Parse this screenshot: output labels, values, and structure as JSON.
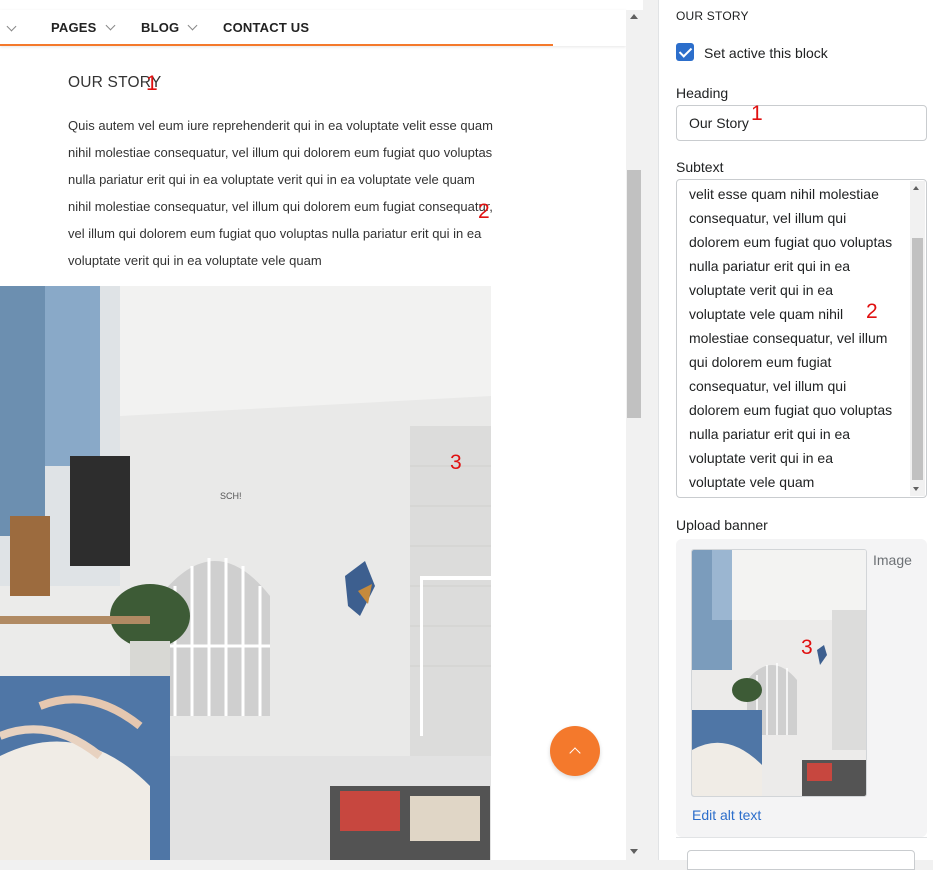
{
  "nav": {
    "items": [
      {
        "label": "PAGES"
      },
      {
        "label": "BLOG"
      },
      {
        "label": "CONTACT US"
      }
    ]
  },
  "preview": {
    "heading": "OUR STORY",
    "text": "Quis autem vel eum iure reprehenderit qui in ea voluptate velit esse quam nihil molestiae consequatur, vel illum qui dolorem eum fugiat quo voluptas nulla pariatur erit qui in ea voluptate verit qui in ea voluptate vele quam nihil molestiae consequatur, vel illum qui dolorem eum fugiat consequatur, vel illum qui dolorem eum fugiat quo voluptas nulla pariatur erit qui in ea voluptate verit qui in ea voluptate vele quam",
    "banner_sign": "SCH!"
  },
  "annotations": {
    "heading_marker": "1",
    "subtext_marker": "2",
    "banner_marker": "3"
  },
  "sidebar": {
    "section_title": "OUR STORY",
    "active_label": "Set active this block",
    "active_checked": true,
    "heading_label": "Heading",
    "heading_value": "Our Story",
    "subtext_label": "Subtext",
    "subtext_value": "velit esse quam nihil molestiae\nconsequatur, vel illum qui\ndolorem eum fugiat quo voluptas\nnulla pariatur erit qui in ea\nvoluptate verit qui in ea\nvoluptate vele quam nihil\nmolestiae consequatur, vel illum\nqui dolorem eum fugiat\nconsequatur, vel illum qui\ndolorem eum fugiat quo voluptas\nnulla pariatur erit qui in ea\nvoluptate verit qui in ea\nvoluptate vele quam",
    "upload_label": "Upload banner",
    "image_caption": "Image",
    "edit_alt_text": "Edit alt text"
  },
  "colors": {
    "accent": "#f4792c",
    "checkbox": "#2c6ecb",
    "link": "#2c6ecb",
    "annotation": "#e01010"
  },
  "icons": [
    "chevron-down-icon",
    "arrow-up-icon",
    "checkmark-icon"
  ]
}
